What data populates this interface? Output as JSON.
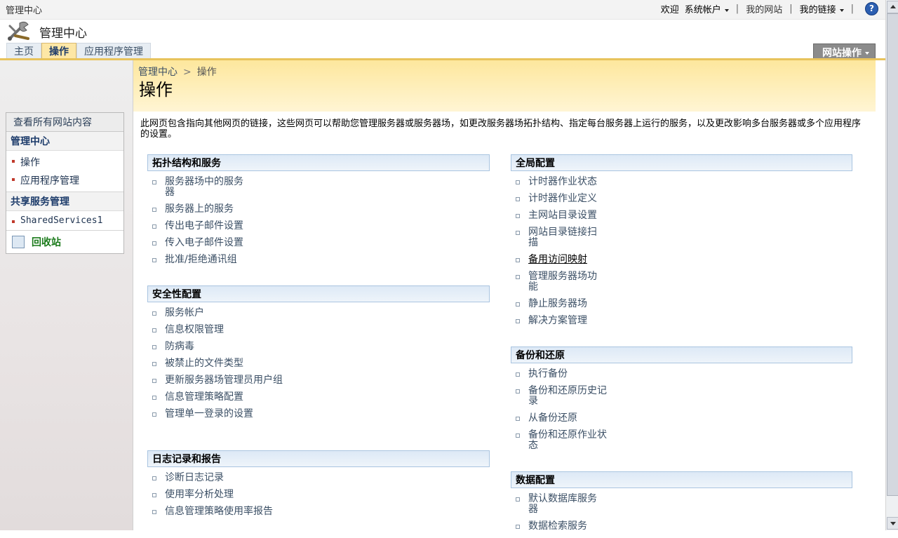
{
  "topbar": {
    "site_name": "管理中心",
    "welcome": "欢迎",
    "user": "系统帐户",
    "my_site": "我的网站",
    "my_links": "我的链接",
    "help_label": "?"
  },
  "header": {
    "title": "管理中心",
    "tabs": [
      {
        "label": "主页",
        "active": false
      },
      {
        "label": "操作",
        "active": true
      },
      {
        "label": "应用程序管理",
        "active": false
      }
    ],
    "site_actions": "网站操作"
  },
  "quick_launch": {
    "view_all": "查看所有网站内容",
    "section1": "管理中心",
    "items1": [
      "操作",
      "应用程序管理"
    ],
    "section2": "共享服务管理",
    "items2": [
      "SharedServices1"
    ],
    "recycle": "回收站"
  },
  "title_area": {
    "crumb_root": "管理中心",
    "crumb_sep": ">",
    "crumb_current": "操作",
    "page_title": "操作"
  },
  "description": "此网页包含指向其他网页的链接，这些网页可以帮助您管理服务器或服务器场，如更改服务器场拓扑结构、指定每台服务器上运行的服务，以及更改影响多台服务器或多个应用程序的设置。",
  "sections": {
    "topology": {
      "title": "拓扑结构和服务",
      "links": [
        "服务器场中的服务器",
        "服务器上的服务",
        "传出电子邮件设置",
        "传入电子邮件设置",
        "批准/拒绝通讯组"
      ]
    },
    "security": {
      "title": "安全性配置",
      "links": [
        "服务帐户",
        "信息权限管理",
        "防病毒",
        "被禁止的文件类型",
        "更新服务器场管理员用户组",
        "信息管理策略配置",
        "管理单一登录的设置"
      ]
    },
    "logging": {
      "title": "日志记录和报告",
      "links": [
        "诊断日志记录",
        "使用率分析处理",
        "信息管理策略使用率报告"
      ]
    },
    "global": {
      "title": "全局配置",
      "links": [
        "计时器作业状态",
        "计时器作业定义",
        "主网站目录设置",
        "网站目录链接扫描",
        "备用访问映射",
        "管理服务器场功能",
        "静止服务器场",
        "解决方案管理"
      ]
    },
    "backup": {
      "title": "备份和还原",
      "links": [
        "执行备份",
        "备份和还原历史记录",
        "从备份还原",
        "备份和还原作业状态"
      ]
    },
    "data": {
      "title": "数据配置",
      "links": [
        "默认数据库服务器",
        "数据检索服务"
      ]
    }
  }
}
